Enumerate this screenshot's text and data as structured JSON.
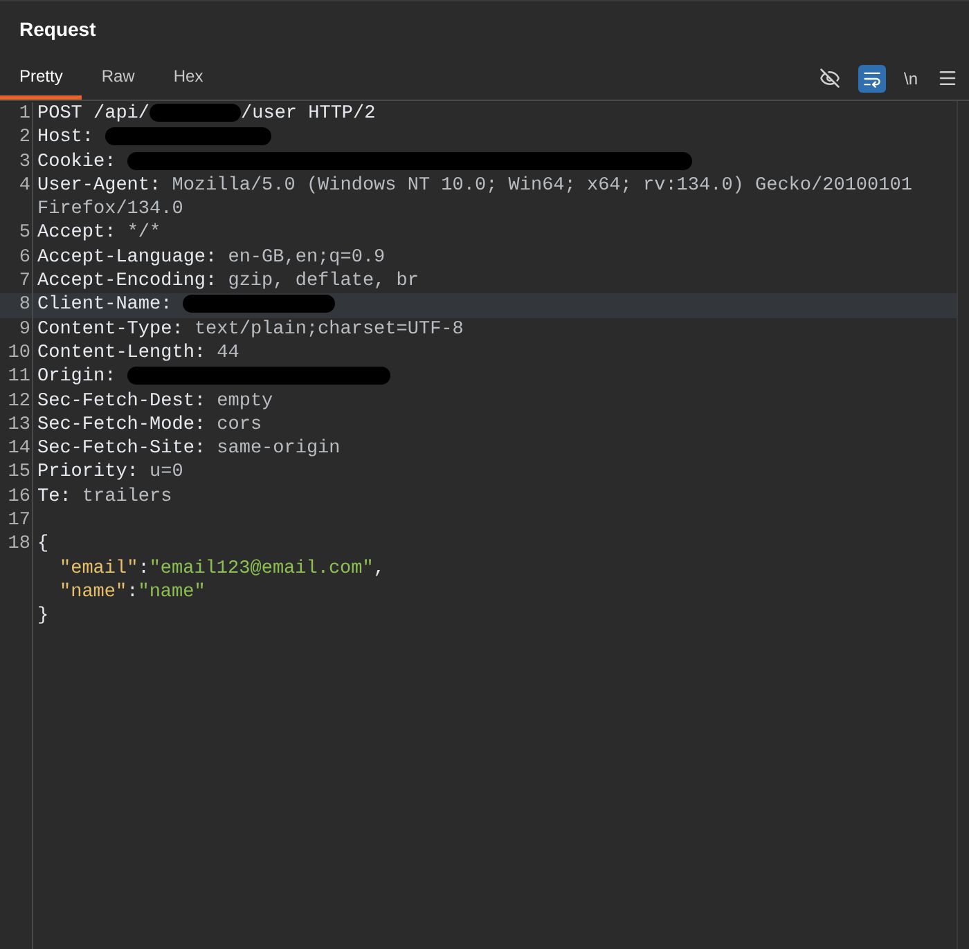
{
  "panel": {
    "title": "Request"
  },
  "tabs": [
    {
      "label": "Pretty",
      "selected": true
    },
    {
      "label": "Raw",
      "selected": false
    },
    {
      "label": "Hex",
      "selected": false
    }
  ],
  "toolbar": {
    "hide_toggle": {
      "on": false
    },
    "wrap_toggle": {
      "on": true
    },
    "newline_label": "\\n"
  },
  "lines": [
    {
      "number": "1",
      "kind": "request",
      "start": "POST /api/",
      "redacted": true,
      "end": "/user HTTP/2",
      "highlighted": false
    },
    {
      "number": "2",
      "kind": "header",
      "name": "Host:",
      "redacted": true,
      "highlighted": false
    },
    {
      "number": "3",
      "kind": "header",
      "name": "Cookie:",
      "redacted": true,
      "highlighted": false
    },
    {
      "number": "4",
      "kind": "header",
      "name": "User-Agent:",
      "value": "Mozilla/5.0 (Windows NT 10.0; Win64; x64; rv:134.0) Gecko/20100101 Firefox/134.0",
      "redacted": false,
      "highlighted": false
    },
    {
      "number": "5",
      "kind": "header",
      "name": "Accept:",
      "value": "*/*",
      "redacted": false,
      "highlighted": false
    },
    {
      "number": "6",
      "kind": "header",
      "name": "Accept-Language:",
      "value": "en-GB,en;q=0.9",
      "redacted": false,
      "highlighted": false
    },
    {
      "number": "7",
      "kind": "header",
      "name": "Accept-Encoding:",
      "value": "gzip, deflate, br",
      "redacted": false,
      "highlighted": false
    },
    {
      "number": "8",
      "kind": "header",
      "name": "Client-Name:",
      "redacted": true,
      "highlighted": true
    },
    {
      "number": "9",
      "kind": "header",
      "name": "Content-Type:",
      "value": "text/plain;charset=UTF-8",
      "redacted": false,
      "highlighted": false
    },
    {
      "number": "10",
      "kind": "header",
      "name": "Content-Length:",
      "value": "44",
      "redacted": false,
      "highlighted": false
    },
    {
      "number": "11",
      "kind": "header",
      "name": "Origin:",
      "redacted": true,
      "highlighted": false
    },
    {
      "number": "12",
      "kind": "header",
      "name": "Sec-Fetch-Dest:",
      "value": "empty",
      "redacted": false,
      "highlighted": false
    },
    {
      "number": "13",
      "kind": "header",
      "name": "Sec-Fetch-Mode:",
      "value": "cors",
      "redacted": false,
      "highlighted": false
    },
    {
      "number": "14",
      "kind": "header",
      "name": "Sec-Fetch-Site:",
      "value": "same-origin",
      "redacted": false,
      "highlighted": false
    },
    {
      "number": "15",
      "kind": "header",
      "name": "Priority:",
      "value": "u=0",
      "redacted": false,
      "highlighted": false
    },
    {
      "number": "16",
      "kind": "header",
      "name": "Te:",
      "value": "trailers",
      "redacted": false,
      "highlighted": false
    },
    {
      "number": "17",
      "kind": "blank",
      "highlighted": false
    },
    {
      "number": "18",
      "kind": "body",
      "highlighted": false,
      "body": [
        {
          "kind": "brace",
          "text": "{"
        },
        {
          "kind": "pair",
          "key": "\"email\"",
          "sep": ":",
          "value": "\"email123@email.com\"",
          "tail": ","
        },
        {
          "kind": "pair",
          "key": "\"name\"",
          "sep": ":",
          "value": "\"name\""
        },
        {
          "kind": "brace",
          "text": "}"
        }
      ]
    }
  ]
}
